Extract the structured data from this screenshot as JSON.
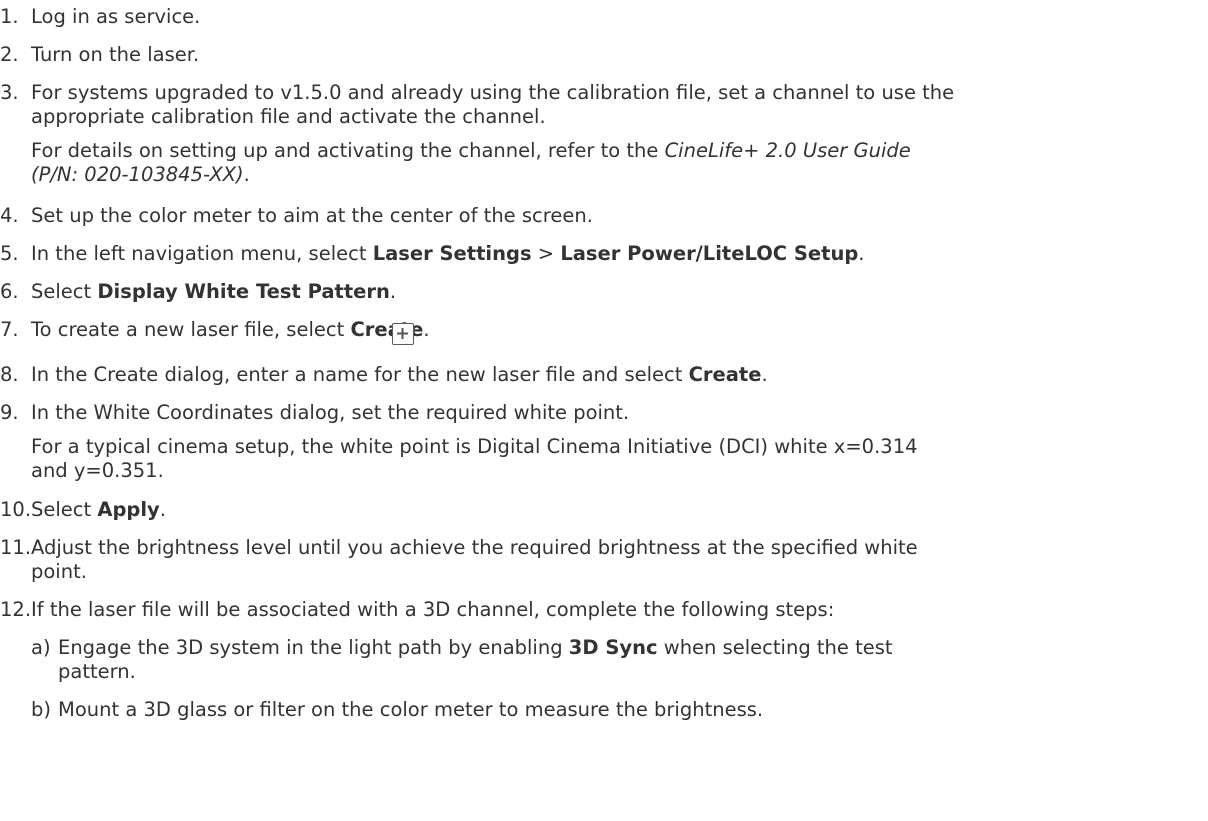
{
  "steps": [
    {
      "num": "1.",
      "lines": [
        "Log in as service."
      ]
    },
    {
      "num": "2.",
      "lines": [
        "Turn on the laser."
      ]
    },
    {
      "num": "3.",
      "lines": [
        "For systems upgraded to v1.5.0 and already using the calibration file, set a channel to use the",
        "appropriate calibration file and activate the channel."
      ],
      "note_prefix": "For details on setting up and activating the channel, refer to the ",
      "note_ref_line1": "CineLife+ 2.0 User Guide",
      "note_ref_line2": "(P/N: 020-103845-XX)",
      "note_suffix": "."
    },
    {
      "num": "4.",
      "lines": [
        "Set up the color meter to aim at the center of the screen."
      ]
    },
    {
      "num": "5.",
      "prefix": "In the left navigation menu, select ",
      "bold1": "Laser Settings",
      "sep": " > ",
      "bold2": "Laser Power/LiteLOC Setup",
      "suffix": "."
    },
    {
      "num": "6.",
      "prefix": "Select ",
      "bold1": "Display White Test Pattern",
      "suffix": "."
    },
    {
      "num": "7.",
      "prefix": "To create a new laser file, select ",
      "bold1": "Create",
      "suffix": ".",
      "icon": "plus-square-icon"
    },
    {
      "num": "8.",
      "prefix": "In the Create dialog, enter a name for the new laser file and select ",
      "bold1": "Create",
      "suffix": "."
    },
    {
      "num": "9.",
      "lines": [
        "In the White Coordinates dialog, set the required white point."
      ],
      "note_lines": [
        "For a typical cinema setup, the white point is Digital Cinema Initiative (DCI) white x=0.314",
        "and y=0.351."
      ]
    },
    {
      "num": "10.",
      "prefix": "Select ",
      "bold1": "Apply",
      "suffix": "."
    },
    {
      "num": "11.",
      "lines": [
        "Adjust the brightness level until you achieve the required brightness at the specified white",
        "point."
      ]
    },
    {
      "num": "12.",
      "lines": [
        "If the laser file will be associated with a 3D channel, complete the following steps:"
      ]
    }
  ],
  "substeps": [
    {
      "num": "a)",
      "prefix": "Engage the 3D system in the light path by enabling ",
      "bold1": "3D Sync",
      "suffix": " when selecting the test",
      "line2": "pattern."
    },
    {
      "num": "b)",
      "lines": [
        "Mount a 3D glass or filter on the color meter to measure the brightness."
      ]
    }
  ]
}
